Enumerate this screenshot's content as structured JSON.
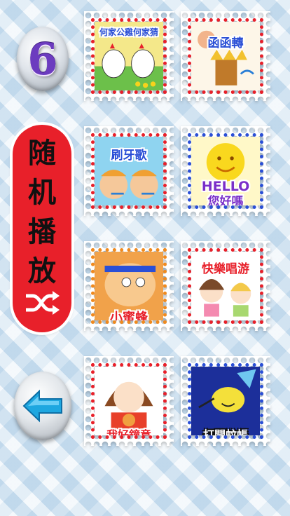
{
  "badge": {
    "number": "6"
  },
  "shuffle": {
    "chars": [
      "随",
      "机",
      "播",
      "放"
    ],
    "icon": "shuffle-icon"
  },
  "back": {
    "icon": "back-arrow-icon"
  },
  "songs": [
    {
      "title": "何家公雞何家猜",
      "color": "#2a4fd6"
    },
    {
      "title": "函函轉",
      "color": "#2a4fd6"
    },
    {
      "title": "刷牙歌",
      "color": "#2a4fd6"
    },
    {
      "title_line1": "HELLO",
      "title_line2": "您好嗎",
      "color": "#7a2fc9"
    },
    {
      "title": "小蜜蜂",
      "color": "#e8202a"
    },
    {
      "title": "快樂唱游",
      "color": "#e8202a"
    },
    {
      "title": "我好鐘意",
      "color": "#e8202a"
    },
    {
      "title": "打開蚊帳",
      "color": "#ffffff"
    }
  ],
  "colors": {
    "shuffle_red": "#e8202a",
    "badge_purple": "#6c3cbf",
    "back_arrow": "#1ea7e0"
  }
}
